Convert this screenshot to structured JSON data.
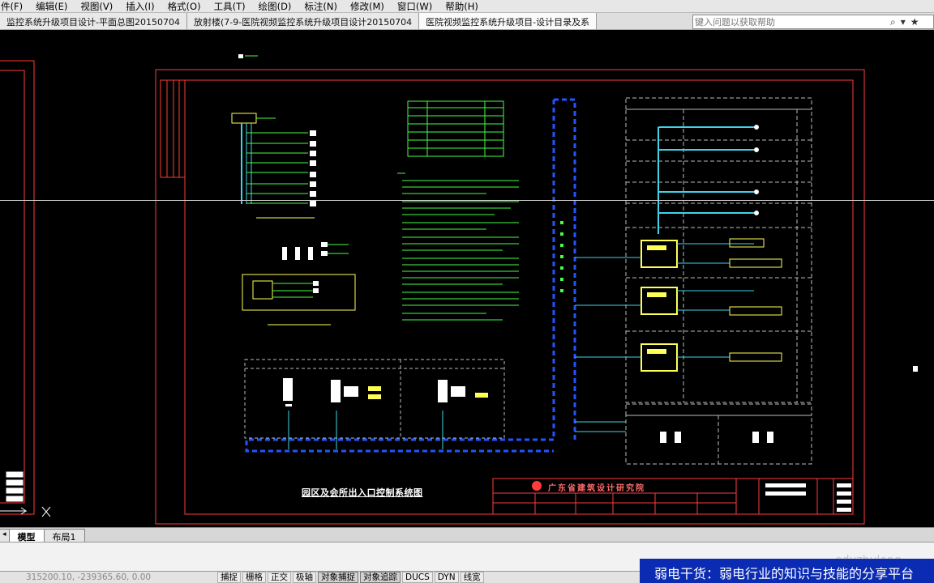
{
  "menu": {
    "items": [
      "件(F)",
      "编辑(E)",
      "视图(V)",
      "插入(I)",
      "格式(O)",
      "工具(T)",
      "绘图(D)",
      "标注(N)",
      "修改(M)",
      "窗口(W)",
      "帮助(H)"
    ]
  },
  "doc_tabs": [
    "监控系统升级项目设计-平面总图20150704",
    "放射楼(7-9-医院视频监控系统升级项目设计20150704",
    "医院视频监控系统升级项目-设计目录及系"
  ],
  "help_search": {
    "placeholder": "键入问题以获取帮助"
  },
  "drawing": {
    "title": "园区及会所出入口控制系统图",
    "institute": "广东省建筑设计研究院",
    "colors": {
      "frame": "#ff3b3b",
      "cable": "#3fd4e8",
      "text": "#44ff44",
      "device": "#ffff55",
      "white": "#ffffff",
      "bus": "#2255ff"
    }
  },
  "layout_tabs": [
    "模型",
    "布局1"
  ],
  "status": {
    "coords": "315200.10, -239365.60, 0.00",
    "toggles": [
      "捕捉",
      "栅格",
      "正交",
      "极轴",
      "对象捕捉",
      "对象追踪",
      "DUCS",
      "DYN",
      "线宽"
    ]
  },
  "banner": {
    "text": "弱电干货：弱电行业的知识与技能的分享平台"
  },
  "watermark": {
    "text": "eduzhulong"
  }
}
